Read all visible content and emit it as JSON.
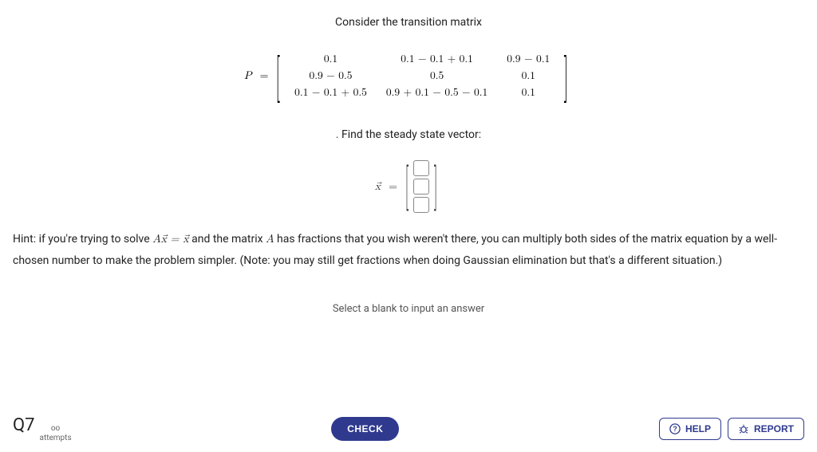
{
  "header": {
    "prompt": "Consider the transition matrix"
  },
  "matrix": {
    "label": "P",
    "eq": "=",
    "rows": [
      [
        "0.1",
        "0.1 − 0.1 + 0.1",
        "0.9 − 0.1"
      ],
      [
        "0.9 − 0.5",
        "0.5",
        "0.1"
      ],
      [
        "0.1 − 0.1 + 0.5",
        "0.9 + 0.1 − 0.5 − 0.1",
        "0.1"
      ]
    ]
  },
  "subprompt": ". Find the steady state vector:",
  "vector": {
    "label": "x⃗",
    "eq": "=",
    "n": 3
  },
  "hint": {
    "prefix": "Hint: if you're trying to solve ",
    "eqn": "Ax⃗ = x⃗",
    "mid1": " and the matrix ",
    "A": "A",
    "mid2": " has fractions that you wish weren't there, you can multiply both sides of the matrix equation by a well-chosen number to make the problem simpler. (Note: you may still get fractions when doing Gaussian elimination but that's a different situation.)"
  },
  "footer_hint": "Select a blank to input an answer",
  "bottom": {
    "qnum": "Q7",
    "attempts_symbol": "oo",
    "attempts_label": "attempts",
    "check": "CHECK",
    "help": "HELP",
    "report": "REPORT"
  }
}
